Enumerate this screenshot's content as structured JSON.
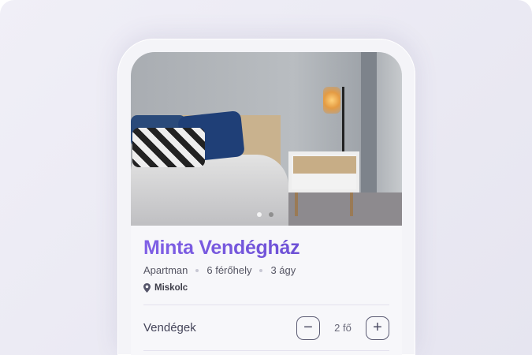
{
  "listing": {
    "title": "Minta Vendégház",
    "type": "Apartman",
    "capacity": "6 férőhely",
    "beds": "3 ágy",
    "location": "Miskolc",
    "photo_index": 1,
    "photo_count": 2
  },
  "guests": {
    "label": "Vendégek",
    "value": "2 fő",
    "minus": "−",
    "plus": "+"
  },
  "colors": {
    "accent": "#7252d8"
  }
}
